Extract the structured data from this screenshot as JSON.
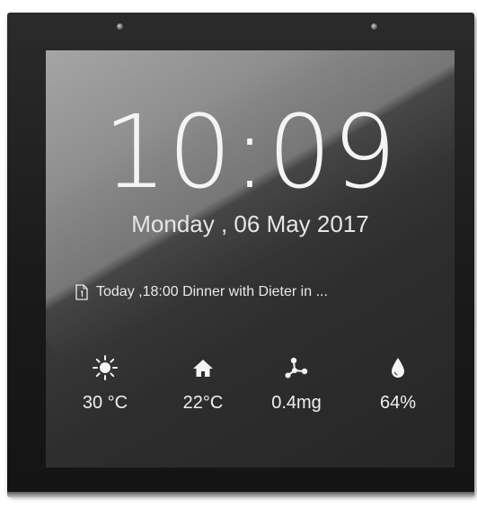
{
  "clock": {
    "time": "10:09",
    "date": "Monday , 06 May 2017"
  },
  "event": {
    "icon": "calendar-doc-icon",
    "text": "Today ,18:00  Dinner with Dieter in ..."
  },
  "sensors": [
    {
      "icon": "sun-icon",
      "value": "30 °C"
    },
    {
      "icon": "home-icon",
      "value": "22°C"
    },
    {
      "icon": "molecule-icon",
      "value": "0.4mg"
    },
    {
      "icon": "water-drop-icon",
      "value": "64%"
    }
  ]
}
